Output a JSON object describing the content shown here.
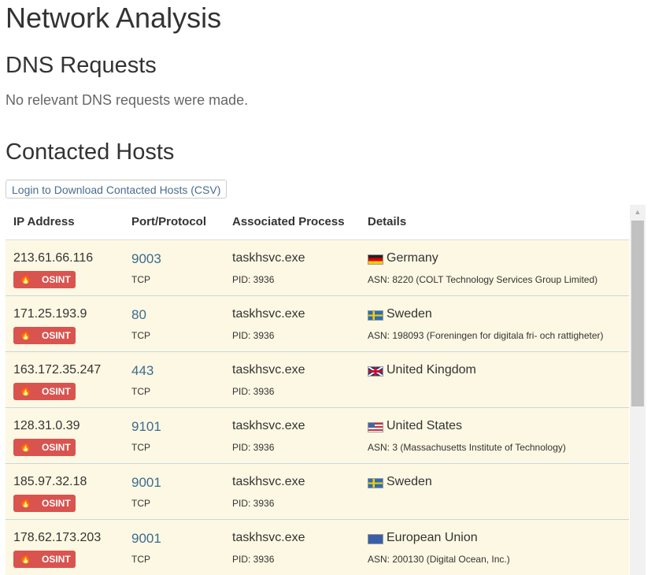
{
  "page_title": "Network Analysis",
  "dns": {
    "heading": "DNS Requests",
    "note": "No relevant DNS requests were made."
  },
  "hosts": {
    "heading": "Contacted Hosts",
    "csv_button": "Login to Download Contacted Hosts (CSV)",
    "columns": [
      "IP Address",
      "Port/Protocol",
      "Associated Process",
      "Details"
    ],
    "osint_label": "OSINT",
    "rows": [
      {
        "ip": "213.61.66.116",
        "port": "9003",
        "protocol": "TCP",
        "process": "taskhsvc.exe",
        "pid": "PID: 3936",
        "flag": "germany-flag-icon",
        "country": "Germany",
        "asn": "ASN: 8220 (COLT Technology Services Group Limited)"
      },
      {
        "ip": "171.25.193.9",
        "port": "80",
        "protocol": "TCP",
        "process": "taskhsvc.exe",
        "pid": "PID: 3936",
        "flag": "sweden-flag-icon",
        "country": "Sweden",
        "asn": "ASN: 198093 (Foreningen for digitala fri- och rattigheter)"
      },
      {
        "ip": "163.172.35.247",
        "port": "443",
        "protocol": "TCP",
        "process": "taskhsvc.exe",
        "pid": "PID: 3936",
        "flag": "uk-flag-icon",
        "country": "United Kingdom",
        "asn": ""
      },
      {
        "ip": "128.31.0.39",
        "port": "9101",
        "protocol": "TCP",
        "process": "taskhsvc.exe",
        "pid": "PID: 3936",
        "flag": "us-flag-icon",
        "country": "United States",
        "asn": "ASN: 3 (Massachusetts Institute of Technology)"
      },
      {
        "ip": "185.97.32.18",
        "port": "9001",
        "protocol": "TCP",
        "process": "taskhsvc.exe",
        "pid": "PID: 3936",
        "flag": "sweden-flag-icon",
        "country": "Sweden",
        "asn": ""
      },
      {
        "ip": "178.62.173.203",
        "port": "9001",
        "protocol": "TCP",
        "process": "taskhsvc.exe",
        "pid": "PID: 3936",
        "flag": "eu-flag-icon",
        "country": "European Union",
        "asn": "ASN: 200130 (Digital Ocean, Inc.)"
      }
    ]
  },
  "colors": {
    "row_background": "#fcf8e3",
    "osint_badge": "#d9534f",
    "port_link": "#3d6b8e"
  }
}
